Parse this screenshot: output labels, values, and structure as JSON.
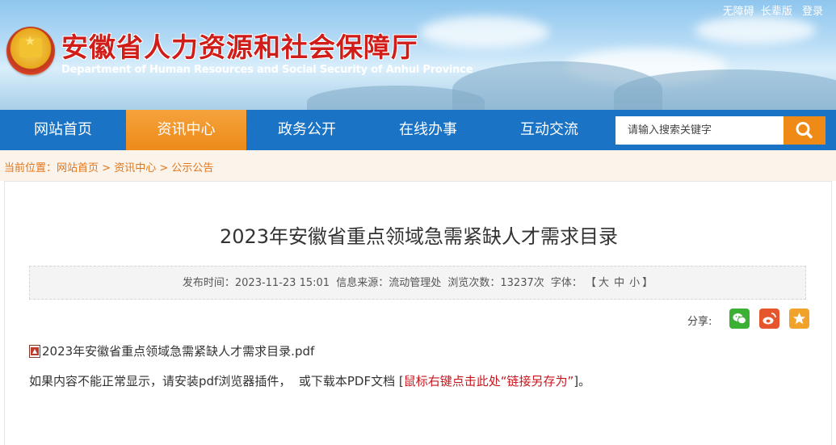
{
  "top_links": {
    "accessibility": "无障碍",
    "elder_mode": "长辈版",
    "login": "登录"
  },
  "site": {
    "title": "安徽省人力资源和社会保障厅",
    "subtitle": "Department of Human Resources and Social Security of Anhui Province"
  },
  "nav": {
    "items": [
      {
        "label": "网站首页"
      },
      {
        "label": "资讯中心"
      },
      {
        "label": "政务公开"
      },
      {
        "label": "在线办事"
      },
      {
        "label": "互动交流"
      }
    ],
    "active_index": 1,
    "search_placeholder": "请输入搜索关键字"
  },
  "breadcrumb": {
    "prefix": "当前位置：",
    "items": [
      "网站首页",
      "资讯中心",
      "公示公告"
    ],
    "separator": " > "
  },
  "article": {
    "title": "2023年安徽省重点领域急需紧缺人才需求目录",
    "meta": {
      "publish_label": "发布时间：",
      "publish_time": "2023-11-23 15:01",
      "source_label": "信息来源：",
      "source": "流动管理处",
      "views_label": "浏览次数：",
      "views": "13237次",
      "font_label": "字体：",
      "bracket_open": "【",
      "font_large": "大",
      "font_medium": "中",
      "font_small": "小",
      "bracket_close": "】"
    },
    "share_label": "分享:",
    "share_icons": [
      "wechat-icon",
      "weibo-icon",
      "favorite-icon"
    ],
    "attachment": "2023年安徽省重点领域急需紧缺人才需求目录.pdf",
    "notice_text": "如果内容不能正常显示，请安装pdf浏览器插件，  或下载本PDF文档 [",
    "notice_link": "鼠标右键点击此处“链接另存为”",
    "notice_end": "]。"
  },
  "colors": {
    "nav_bg": "#1a73c4",
    "nav_active": "#ef8a17",
    "title_red": "#d11d19",
    "crumb_orange": "#e1751a",
    "wechat": "#3cb034",
    "weibo": "#e6562d",
    "favorite": "#f0a32a"
  }
}
